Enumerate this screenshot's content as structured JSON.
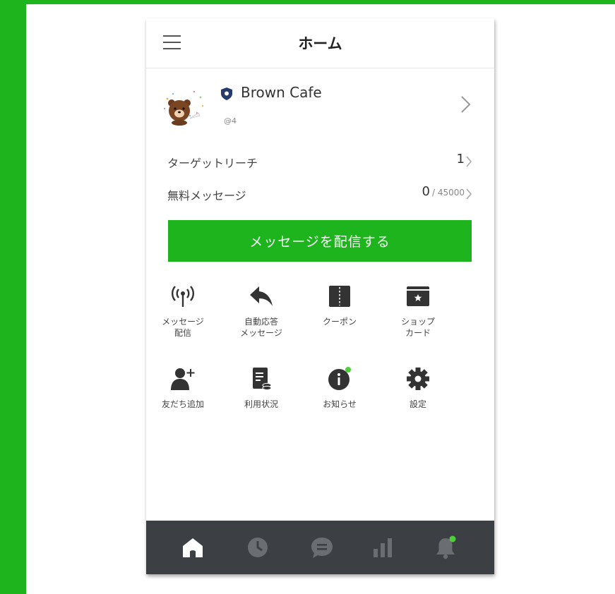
{
  "header": {
    "title": "ホーム",
    "menu_icon": "hamburger-icon"
  },
  "account": {
    "name": "Brown Cafe",
    "id": "@4",
    "badge_icon": "shield-icon"
  },
  "stats": [
    {
      "label": "ターゲットリーチ",
      "value": "1",
      "suffix": ""
    },
    {
      "label": "無料メッセージ",
      "value": "0",
      "suffix": "/ 45000"
    }
  ],
  "cta": {
    "label": "メッセージを配信する"
  },
  "tiles": [
    {
      "label": "メッセージ\n配信",
      "icon": "broadcast-icon"
    },
    {
      "label": "自動応答\nメッセージ",
      "icon": "reply-arrow-icon"
    },
    {
      "label": "クーポン",
      "icon": "coupon-icon"
    },
    {
      "label": "ショップ\nカード",
      "icon": "shop-card-icon"
    },
    {
      "label": "友だち追加",
      "icon": "add-friend-icon"
    },
    {
      "label": "利用状況",
      "icon": "usage-icon"
    },
    {
      "label": "お知らせ",
      "icon": "info-icon"
    },
    {
      "label": "設定",
      "icon": "gear-icon"
    }
  ],
  "tabbar": {
    "items": [
      "home-icon",
      "clock-icon",
      "chat-icon",
      "chart-icon",
      "bell-icon"
    ],
    "active_color": "#ffffff",
    "inactive_color": "#6a6d71",
    "dot_color": "#4cd137"
  },
  "colors": {
    "brand_green": "#1db41d",
    "tabbar_bg": "#3c3f43",
    "badge_dot": "#4cd137"
  }
}
